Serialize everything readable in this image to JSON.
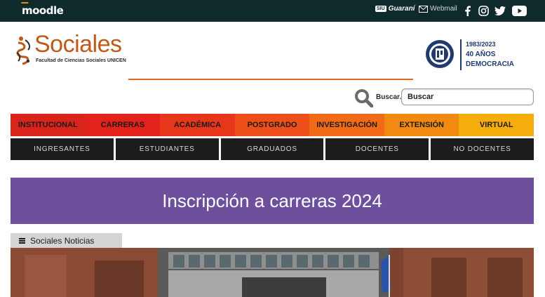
{
  "topbar": {
    "moodle_label": "moodle",
    "siu_badge": "SIU",
    "guarani_label": "Guaraní",
    "webmail_label": "Webmail",
    "socials": [
      "facebook-icon",
      "instagram-icon",
      "twitter-icon",
      "youtube-icon"
    ],
    "bg_color": "#0f2a2b"
  },
  "header": {
    "logo_title": "Sociales",
    "logo_subtitle": "Facultad de Ciencias Sociales UNICEN",
    "democracy": {
      "years": "1983/2023",
      "line1": "40 AÑOS",
      "line2": "DEMOCRACIA"
    },
    "accent_color": "#c2571a"
  },
  "search": {
    "label": "Buscar...",
    "placeholder": "Buscar"
  },
  "main_nav": [
    {
      "label": "INSTITUCIONAL",
      "color": "#d9241b"
    },
    {
      "label": "CARRERAS",
      "color": "#e3231b"
    },
    {
      "label": "ACADÉMICA",
      "color": "#e8361a"
    },
    {
      "label": "POSTGRADO",
      "color": "#ee4e19"
    },
    {
      "label": "INVESTIGACIÓN",
      "color": "#f06a17"
    },
    {
      "label": "EXTENSIÓN",
      "color": "#f28a12"
    },
    {
      "label": "VIRTUAL",
      "color": "#f5ad0c"
    }
  ],
  "sub_nav": [
    {
      "label": "INGRESANTES"
    },
    {
      "label": "ESTUDIANTES"
    },
    {
      "label": "GRADUADOS"
    },
    {
      "label": "DOCENTES"
    },
    {
      "label": "NO DOCENTES"
    }
  ],
  "banner": {
    "text": "Inscripción a carreras 2024",
    "bg_color": "#6e4f9e"
  },
  "news": {
    "tab_label": "Sociales Noticias"
  }
}
